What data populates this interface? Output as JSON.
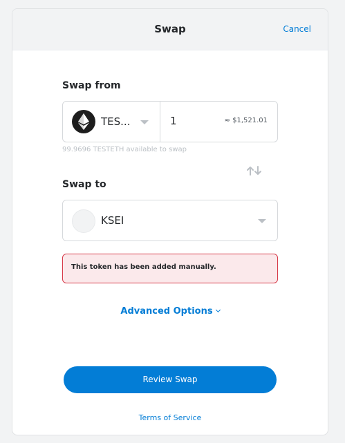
{
  "header": {
    "title": "Swap",
    "cancel_label": "Cancel"
  },
  "swap_from": {
    "label": "Swap from",
    "token_symbol": "TES...",
    "token_icon": "ethereum-icon",
    "amount": "1",
    "fiat_value": "≈ $1,521.01",
    "balance_text": "99.9696 TESTETH available to swap"
  },
  "swap_to": {
    "label": "Swap to",
    "token_symbol": "KSEI",
    "token_icon": "empty-token-icon"
  },
  "warning": {
    "text": "This token has been added manually."
  },
  "advanced_options_label": "Advanced Options",
  "review_button_label": "Review Swap",
  "terms_label": "Terms of Service",
  "colors": {
    "accent": "#037dd6",
    "warning_border": "#d73a49",
    "warning_bg": "#fbe9eb"
  }
}
